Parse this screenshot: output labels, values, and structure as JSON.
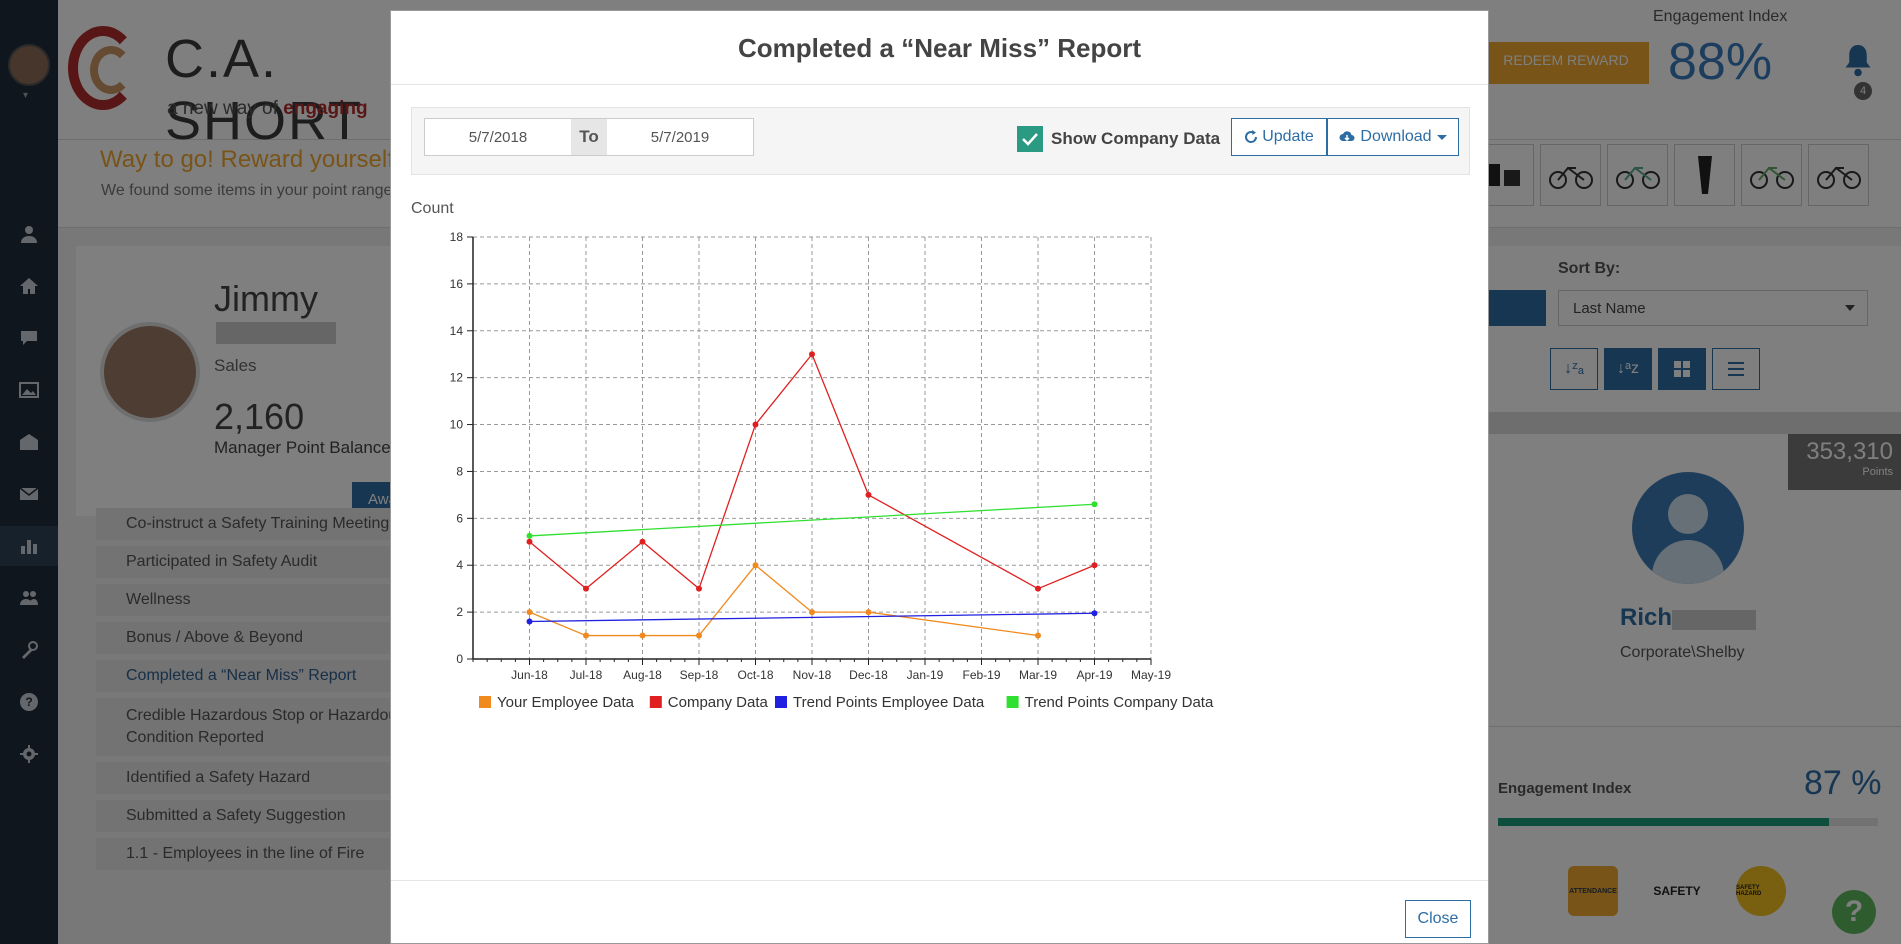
{
  "header": {
    "logo_name": "C.A. SHORT",
    "logo_tag_prefix": "a new way of ",
    "logo_tag_emph": "engaging",
    "reward_button": "REDEEM REWARD",
    "engagement_label": "Engagement Index",
    "engagement_value": "88%",
    "notifications_count": "4"
  },
  "reward_banner": {
    "title": "Way to go! Reward yourself!",
    "subtitle": "We found some items in your point range"
  },
  "profile": {
    "first_name": "Jimmy",
    "role": "Sales",
    "points": "2,160",
    "points_label": "Manager Point Balance",
    "button": "Award"
  },
  "activity_list": [
    "Co-instruct a Safety Training Meeting",
    "Participated in Safety Audit",
    "Wellness",
    "Bonus / Above & Beyond",
    "Completed a “Near Miss” Report",
    "Credible Hazardous Stop or Hazardous",
    "Condition Reported",
    "Identified a Safety Hazard",
    "Submitted a Safety Suggestion",
    "1.1 - Employees in the line of Fire"
  ],
  "right_panel": {
    "sort_label": "Sort By:",
    "sort_value": "Last Name",
    "points_value": "353,310",
    "points_label": "Points",
    "person_first": "Rich",
    "person_dept": "Corporate\\Shelby",
    "engagement_label": "Engagement Index",
    "engagement_value": "87 %",
    "engagement_fraction": 0.87,
    "badges": [
      "ATTENDANCE",
      "SAFETY",
      "SAFETY HAZARD"
    ]
  },
  "modal": {
    "title": "Completed a “Near Miss” Report",
    "date_from": "5/7/2018",
    "date_to_label": "To",
    "date_to": "5/7/2019",
    "show_company_label": "Show Company Data",
    "show_company_checked": true,
    "update_label": "Update",
    "download_label": "Download",
    "close_label": "Close"
  },
  "colors": {
    "employee": "#f08a1e",
    "company": "#e02020",
    "trend_employee": "#2020e0",
    "trend_company": "#30e030",
    "accent": "#2e6da4",
    "check": "#2a9a82"
  },
  "chart_data": {
    "type": "line",
    "ylabel": "Count",
    "xlabel": "",
    "ylim": [
      0,
      18
    ],
    "yticks": [
      0,
      2,
      4,
      6,
      8,
      10,
      12,
      14,
      16,
      18
    ],
    "categories": [
      "Jun-18",
      "Jul-18",
      "Aug-18",
      "Sep-18",
      "Oct-18",
      "Nov-18",
      "Dec-18",
      "Jan-19",
      "Feb-19",
      "Mar-19",
      "Apr-19",
      "May-19"
    ],
    "grid": true,
    "legend_position": "bottom",
    "series": [
      {
        "name": "Your Employee Data",
        "color_key": "employee",
        "values": [
          2,
          1,
          1,
          1,
          4,
          2,
          2,
          null,
          null,
          1,
          null,
          null
        ]
      },
      {
        "name": "Company Data",
        "color_key": "company",
        "values": [
          5,
          3,
          5,
          3,
          10,
          13,
          7,
          null,
          null,
          3,
          4,
          null
        ]
      },
      {
        "name": "Trend Points Employee Data",
        "color_key": "trend_employee",
        "values": [
          1.6,
          null,
          null,
          null,
          null,
          null,
          null,
          null,
          null,
          null,
          1.95,
          null
        ]
      },
      {
        "name": "Trend Points Company Data",
        "color_key": "trend_company",
        "values": [
          5.25,
          null,
          null,
          null,
          null,
          null,
          null,
          null,
          null,
          null,
          6.6,
          null
        ]
      }
    ]
  }
}
